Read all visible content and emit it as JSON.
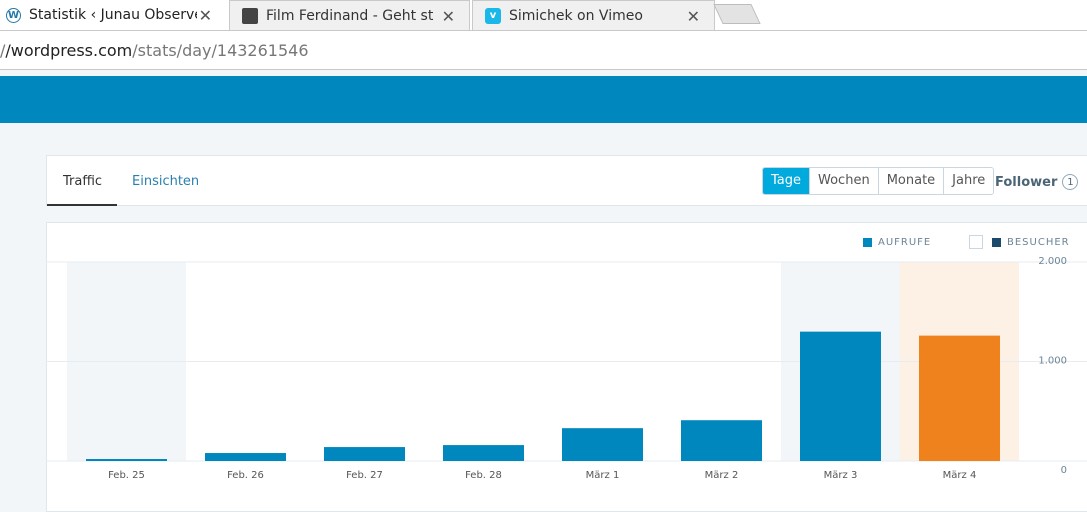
{
  "browser": {
    "tabs": [
      {
        "title": "Statistik ‹ Junau Observer",
        "icon": "wordpress-icon"
      },
      {
        "title": "Film Ferdinand - Geht sti",
        "icon": "clapperboard-icon"
      },
      {
        "title": "Simichek on Vimeo",
        "icon": "vimeo-icon"
      }
    ],
    "url_prefix": "/",
    "url_host": "/wordpress.com",
    "url_path": "/stats/day/143261546"
  },
  "stats_nav": {
    "tab_traffic": "Traffic",
    "tab_insights": "Einsichten",
    "periods": [
      "Tage",
      "Wochen",
      "Monate",
      "Jahre"
    ],
    "selected_period": "Tage",
    "follower_label": "Follower",
    "follower_count": "1"
  },
  "legend": {
    "views": "AUFRUFE",
    "visitors": "BESUCHER"
  },
  "colors": {
    "masterbar": "#0087be",
    "bar": "#0087be",
    "bar_selected": "#f0821e",
    "weekend_band": "#f3f6f8",
    "selected_band": "#fdf1e6",
    "visitors": "#1b4a6b"
  },
  "chart_data": {
    "type": "bar",
    "categories": [
      "Feb. 25",
      "Feb. 26",
      "Feb. 27",
      "Feb. 28",
      "März 1",
      "März 2",
      "März 3",
      "März 4"
    ],
    "series": [
      {
        "name": "AUFRUFE",
        "values": [
          20,
          80,
          140,
          160,
          330,
          410,
          1300,
          1260
        ]
      }
    ],
    "y_tick_labels": [
      "2.000",
      "1.000",
      "0"
    ],
    "ylim": [
      0,
      2000
    ],
    "highlighted_category": "März 4",
    "shaded_categories": [
      "Feb. 25",
      "März 3"
    ]
  }
}
